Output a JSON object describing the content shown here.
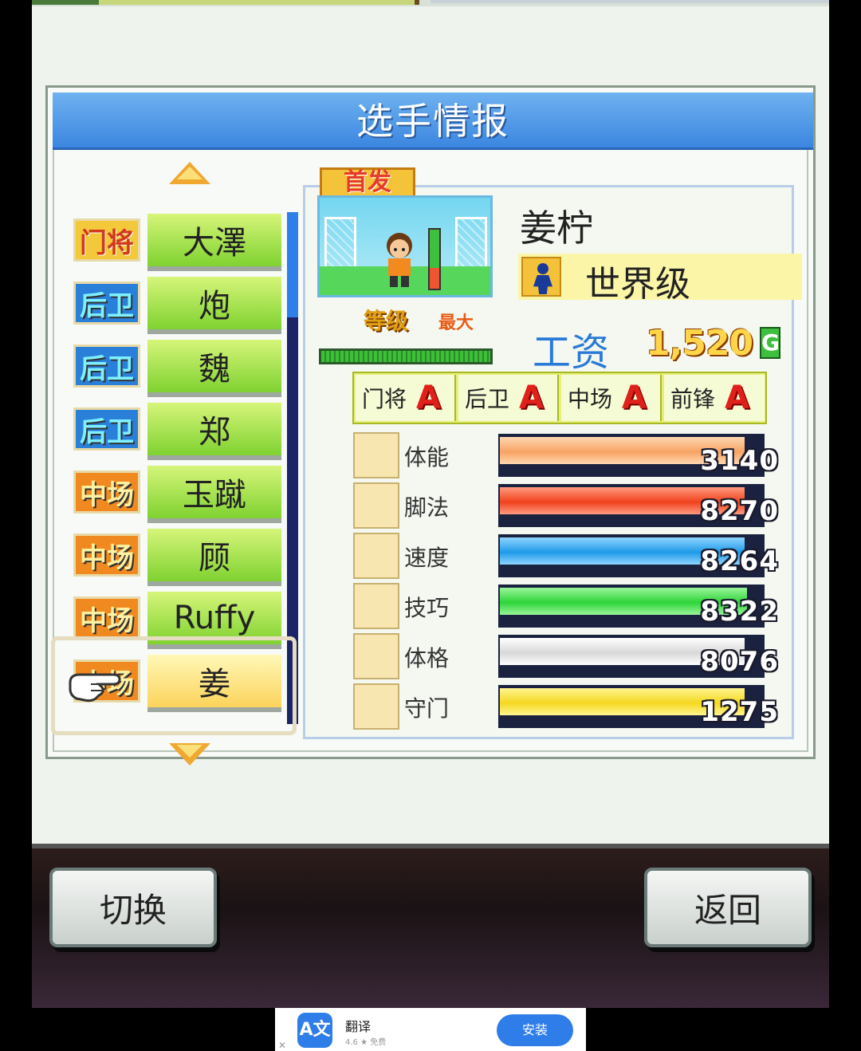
{
  "header": {
    "title": "选手情报"
  },
  "roster": [
    {
      "position": "门将",
      "pos_class": "gk",
      "name": "大澤"
    },
    {
      "position": "后卫",
      "pos_class": "df",
      "name": "炮"
    },
    {
      "position": "后卫",
      "pos_class": "df",
      "name": "魏"
    },
    {
      "position": "后卫",
      "pos_class": "df",
      "name": "郑"
    },
    {
      "position": "中场",
      "pos_class": "mf",
      "name": "玉蹴"
    },
    {
      "position": "中场",
      "pos_class": "mf",
      "name": "顾"
    },
    {
      "position": "中场",
      "pos_class": "mf",
      "name": "Ruffy"
    },
    {
      "position": "中场",
      "pos_class": "mf",
      "name": "姜",
      "selected": true
    }
  ],
  "player": {
    "starter_badge": "首发",
    "name": "姜柠",
    "rank": "世界级",
    "level_label": "等级",
    "level_value": "最大",
    "salary_label": "工资",
    "salary_value": "1,520",
    "salary_unit": "G",
    "aptitudes": [
      {
        "label": "门将",
        "grade": "A"
      },
      {
        "label": "后卫",
        "grade": "A"
      },
      {
        "label": "中场",
        "grade": "A"
      },
      {
        "label": "前锋",
        "grade": "A"
      }
    ],
    "stats": [
      {
        "label": "体能",
        "value": "3140",
        "icon": "battery-icon",
        "fill": 0.93,
        "color": "#f7a364",
        "color2": "#ffd7b0"
      },
      {
        "label": "脚法",
        "value": "8270",
        "icon": "boot-icon",
        "fill": 0.93,
        "color": "#f0421c",
        "color2": "#ff9a80"
      },
      {
        "label": "速度",
        "value": "8264",
        "icon": "running-icon",
        "fill": 0.93,
        "color": "#1e9ae8",
        "color2": "#8fd4ff"
      },
      {
        "label": "技巧",
        "value": "8322",
        "icon": "dribble-icon",
        "fill": 0.94,
        "color": "#2ed43a",
        "color2": "#9af59a"
      },
      {
        "label": "体格",
        "value": "8076",
        "icon": "muscle-icon",
        "fill": 0.93,
        "color": "#d8d8d8",
        "color2": "#ffffff"
      },
      {
        "label": "守门",
        "value": "1275",
        "icon": "glove-icon",
        "fill": 0.93,
        "color": "#f5d820",
        "color2": "#fff590"
      }
    ]
  },
  "buttons": {
    "switch": "切换",
    "back": "返回"
  },
  "ad": {
    "logo": "A文",
    "title": "翻译",
    "rating": "4.6 ★ 免费",
    "install": "安装",
    "close": "✕"
  }
}
